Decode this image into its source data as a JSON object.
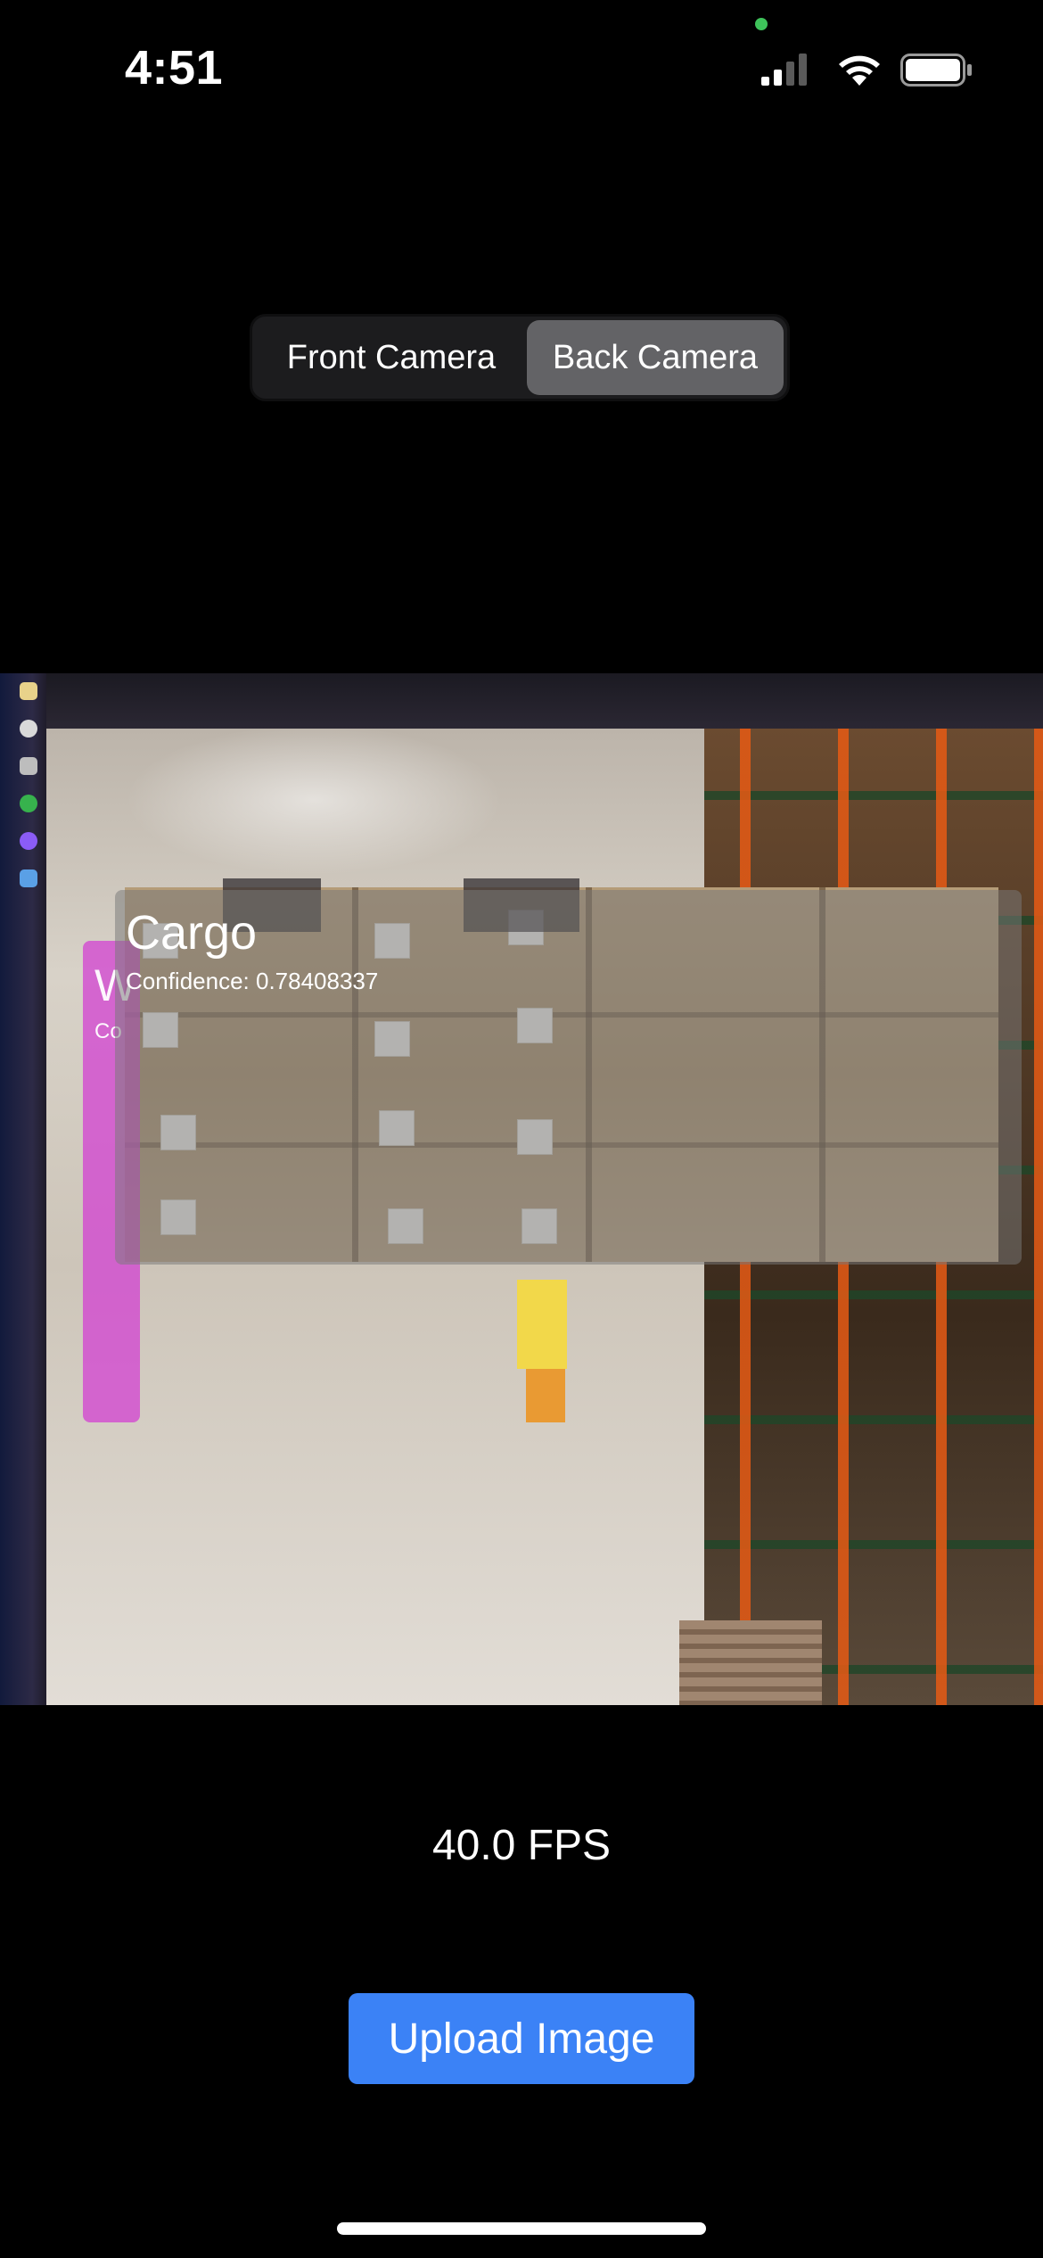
{
  "status_bar": {
    "time": "4:51",
    "icons": [
      "cellular-signal-icon",
      "wifi-icon",
      "battery-icon"
    ],
    "privacy_indicator_color": "#3ec25a"
  },
  "camera_selector": {
    "options": [
      "Front Camera",
      "Back Camera"
    ],
    "selected": "Back Camera"
  },
  "camera_preview": {
    "detections": [
      {
        "label": "Cargo",
        "confidence_text": "Confidence: 0.78408337",
        "color": "#787878"
      },
      {
        "label": "W",
        "confidence_text": "Co",
        "color": "#d23cd2"
      }
    ]
  },
  "fps_text": "40.0 FPS",
  "upload_button_label": "Upload Image",
  "colors": {
    "background": "#000000",
    "accent_button": "#3b82f6",
    "segment_selected": "#636366",
    "segment_track": "#1c1c1e"
  }
}
